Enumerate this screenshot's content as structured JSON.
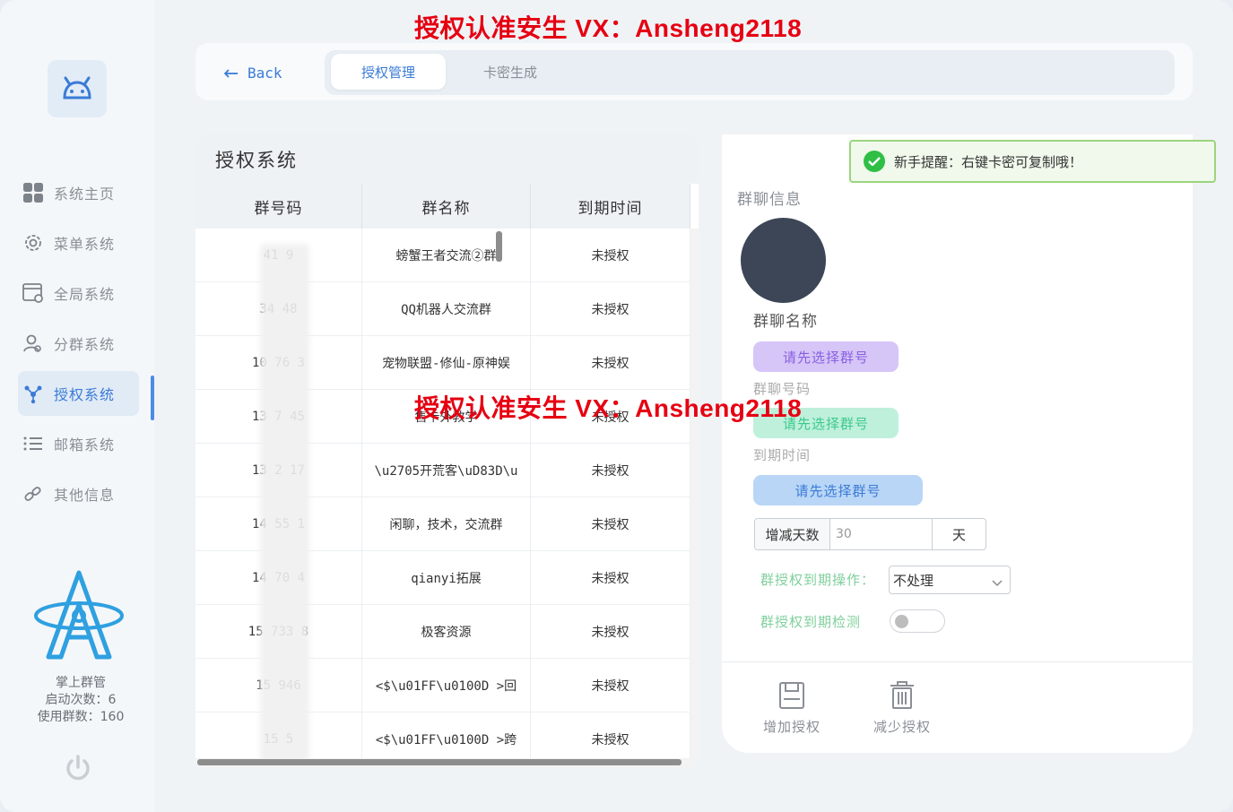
{
  "watermark": "授权认准安生 VX：Ansheng2118",
  "topbar": {
    "back_label": "Back",
    "tabs": [
      {
        "label": "授权管理",
        "active": true
      },
      {
        "label": "卡密生成",
        "active": false
      }
    ]
  },
  "sidebar": {
    "items": [
      {
        "label": "系统主页",
        "icon": "grid-icon"
      },
      {
        "label": "菜单系统",
        "icon": "gear-icon"
      },
      {
        "label": "全局系统",
        "icon": "window-settings-icon"
      },
      {
        "label": "分群系统",
        "icon": "users-icon"
      },
      {
        "label": "授权系统",
        "icon": "network-icon",
        "active": true
      },
      {
        "label": "邮箱系统",
        "icon": "list-icon"
      },
      {
        "label": "其他信息",
        "icon": "link-icon"
      }
    ],
    "app_name": "掌上群管",
    "launch_count": "启动次数：6",
    "group_count": "使用群数：160"
  },
  "table": {
    "title": "授权系统",
    "columns": [
      "群号码",
      "群名称",
      "到期时间"
    ],
    "rows": [
      {
        "id": "41   9",
        "name": "螃蟹王者交流②群",
        "expiry": "未授权"
      },
      {
        "id": "34   48",
        "name": "QQ机器人交流群",
        "expiry": "未授权"
      },
      {
        "id": "10   76   3",
        "name": "宠物联盟-修仙-原神娱",
        "expiry": "未授权"
      },
      {
        "id": "13   7   45",
        "name": "售卡外教学",
        "expiry": "未授权"
      },
      {
        "id": "13   2   17",
        "name": "\\u2705开荒客\\uD83D\\u",
        "expiry": "未授权"
      },
      {
        "id": "14   55   1",
        "name": "闲聊，技术，交流群",
        "expiry": "未授权"
      },
      {
        "id": "14   70   4",
        "name": "qianyi拓展",
        "expiry": "未授权"
      },
      {
        "id": "15   733   8",
        "name": "极客资源",
        "expiry": "未授权"
      },
      {
        "id": "15   946",
        "name": "<$\\u01FF\\u0100D   >回",
        "expiry": "未授权"
      },
      {
        "id": "15       5",
        "name": "<$\\u01FF\\u0100D   >跨",
        "expiry": "未授权"
      }
    ]
  },
  "info": {
    "title": "群聊信息",
    "group_name_label": "群聊名称",
    "select_prompt_1": "请先选择群号",
    "group_number_label": "群聊号码",
    "select_prompt_2": "请先选择群号",
    "expiry_label": "到期时间",
    "select_prompt_3": "请先选择群号",
    "days_label": "增减天数",
    "days_value": "30",
    "days_unit": "天",
    "expire_action_label": "群授权到期操作：",
    "expire_action_value": "不处理",
    "expire_check_label": "群授权到期检测",
    "expire_check_on": false,
    "add_label": "增加授权",
    "remove_label": "减少授权"
  },
  "toast": {
    "text": "新手提醒：右键卡密可复制哦！"
  }
}
